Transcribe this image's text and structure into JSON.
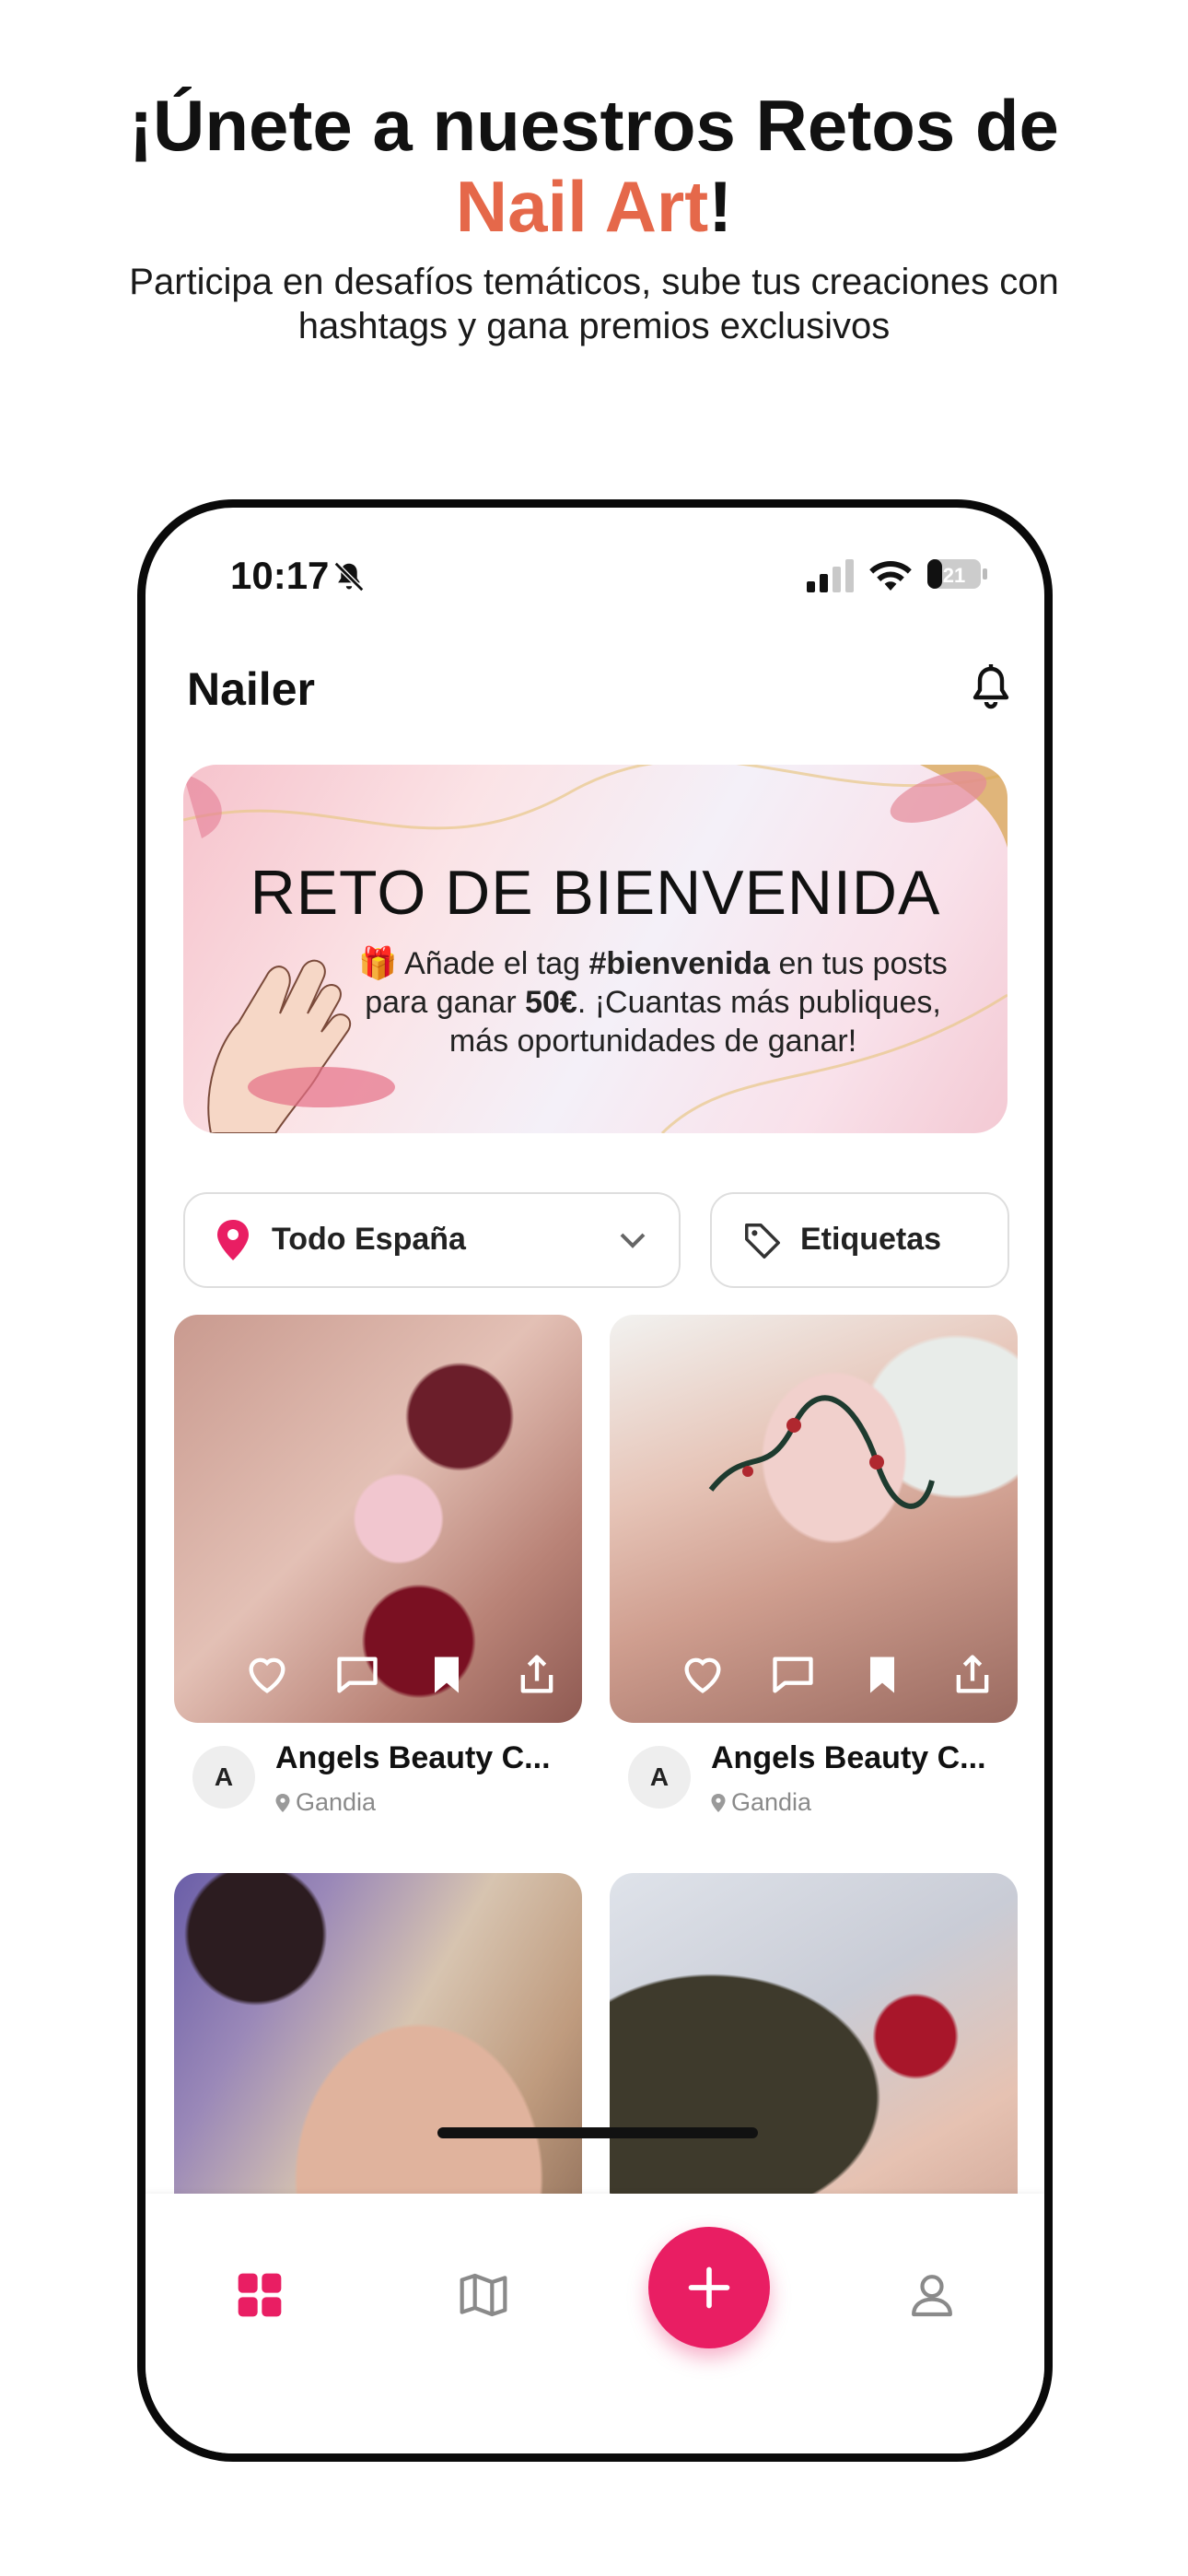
{
  "promo": {
    "title_part1": "¡Únete a nuestros Retos de",
    "title_accent": "Nail Art",
    "title_end": "!",
    "subtitle_line1": "Participa en desafíos temáticos, sube tus creaciones con",
    "subtitle_line2": "hashtags y gana premios exclusivos"
  },
  "status_bar": {
    "time": "10:17",
    "battery": "21"
  },
  "app": {
    "title": "Nailer"
  },
  "banner": {
    "title": "RETO DE BIENVENIDA",
    "text_a": "🎁 Añade el tag ",
    "text_tag": "#bienvenida",
    "text_b": " en tus posts para ganar ",
    "text_amount": "50€",
    "text_c": ". ¡Cuantas más publiques, más oportunidades de ganar!"
  },
  "filters": {
    "location_label": "Todo España",
    "tags_label": "Etiquetas"
  },
  "posts": [
    {
      "avatar_letter": "A",
      "author": "Angels Beauty C...",
      "city": "Gandia"
    },
    {
      "avatar_letter": "A",
      "author": "Angels Beauty C...",
      "city": "Gandia"
    }
  ],
  "colors": {
    "accent": "#e5684a",
    "brand_pink": "#e91e63"
  },
  "nav": {
    "items": [
      "grid-icon",
      "map-icon",
      "add-icon",
      "profile-icon"
    ]
  }
}
